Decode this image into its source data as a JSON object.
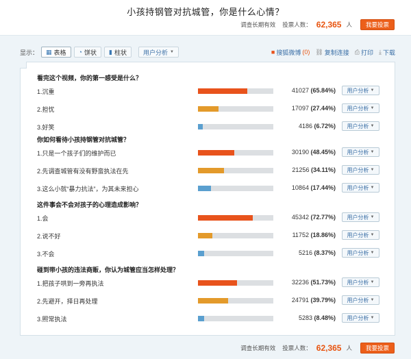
{
  "title": "小孩持钢管对抗城管，你是什么心情？",
  "stats": {
    "validity": "调查长期有效",
    "voters_label": "投票人数：",
    "voters_count": "62,365",
    "voters_unit": "人",
    "vote_button": "我要投票"
  },
  "toolbar": {
    "display_label": "显示：",
    "buttons": [
      {
        "label": "表格",
        "icon": "table-icon"
      },
      {
        "label": "饼状",
        "icon": "pie-chart-icon"
      },
      {
        "label": "柱状",
        "icon": "bar-chart-icon"
      }
    ],
    "user_analysis": "用户分析",
    "weibo_label": "搜狐微博",
    "weibo_count": "(0)",
    "copy_link": "复制连接",
    "print": "打印",
    "download": "下载"
  },
  "colors": {
    "red": "#e8531c",
    "orange": "#e39a2b",
    "blue": "#5a9fcf",
    "accent": "#ec5f1a"
  },
  "user_analysis_label": "用户分析",
  "questions": [
    {
      "text": "看完这个视频，你的第一感受是什么？",
      "options": [
        {
          "label": "1.沉重",
          "count": "41027",
          "pct": "(65.84%)",
          "frac": 0.6584,
          "color": "red"
        },
        {
          "label": "2.担忧",
          "count": "17097",
          "pct": "(27.44%)",
          "frac": 0.2744,
          "color": "orange"
        },
        {
          "label": "3.好笑",
          "count": "4186",
          "pct": "(6.72%)",
          "frac": 0.0672,
          "color": "blue"
        }
      ]
    },
    {
      "text": "你如何看待小孩持钢管对抗城管？",
      "options": [
        {
          "label": "1.只是一个孩子们的维护而已",
          "count": "30190",
          "pct": "(48.45%)",
          "frac": 0.4845,
          "color": "red"
        },
        {
          "label": "2.先调查城管有没有野蛮执法在先",
          "count": "21256",
          "pct": "(34.11%)",
          "frac": 0.3411,
          "color": "orange"
        },
        {
          "label": "3.这么小就“暴力抗法”，为其未来担心",
          "count": "10864",
          "pct": "(17.44%)",
          "frac": 0.1744,
          "color": "blue"
        }
      ]
    },
    {
      "text": "这件事会不会对孩子的心理造成影响？",
      "options": [
        {
          "label": "1.会",
          "count": "45342",
          "pct": "(72.77%)",
          "frac": 0.7277,
          "color": "red"
        },
        {
          "label": "2.说不好",
          "count": "11752",
          "pct": "(18.86%)",
          "frac": 0.1886,
          "color": "orange"
        },
        {
          "label": "3.不会",
          "count": "5216",
          "pct": "(8.37%)",
          "frac": 0.0837,
          "color": "blue"
        }
      ]
    },
    {
      "text": "碰到带小孩的违法商贩，你认为城管应当怎样处理？",
      "options": [
        {
          "label": "1.把孩子哄到一旁再执法",
          "count": "32236",
          "pct": "(51.73%)",
          "frac": 0.5173,
          "color": "red"
        },
        {
          "label": "2.先避开，择日再处理",
          "count": "24791",
          "pct": "(39.79%)",
          "frac": 0.3979,
          "color": "orange"
        },
        {
          "label": "3.照常执法",
          "count": "5283",
          "pct": "(8.48%)",
          "frac": 0.0848,
          "color": "blue"
        }
      ]
    }
  ]
}
